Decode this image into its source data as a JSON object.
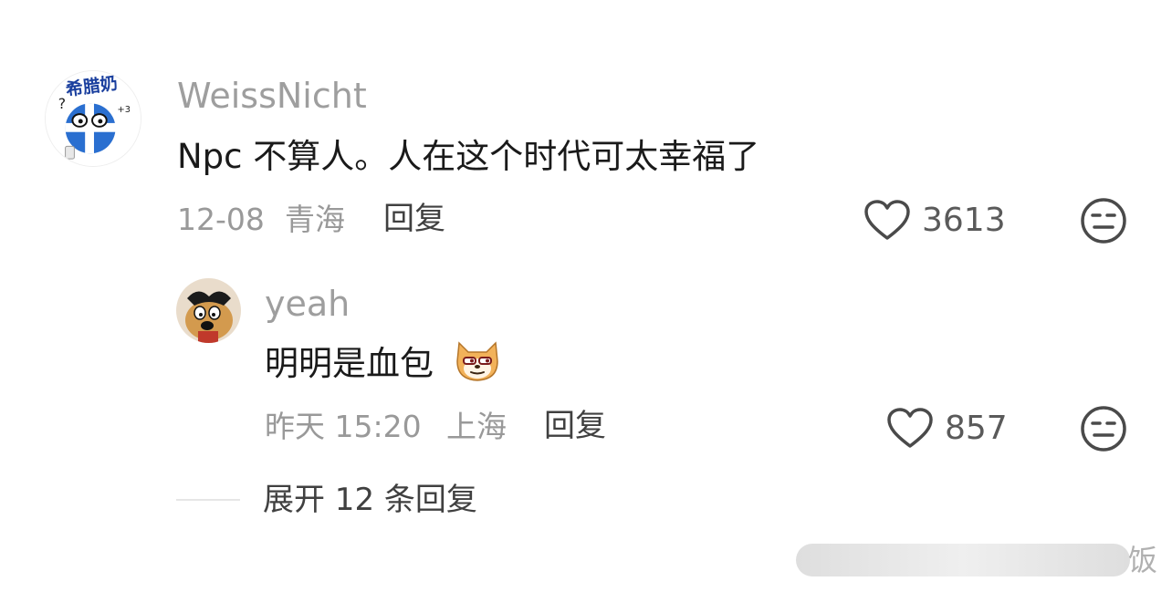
{
  "comment": {
    "username": "WeissNicht",
    "text": "Npc 不算人。人在这个时代可太幸福了",
    "date": "12-08",
    "location": "青海",
    "reply_label": "回复",
    "likes": "3613",
    "avatar_text": "希腊奶"
  },
  "reply": {
    "username": "yeah",
    "text": "明明是血包",
    "emoji": "doge-shiba-emoji",
    "date": "昨天 15:20",
    "location": "上海",
    "reply_label": "回复",
    "likes": "857"
  },
  "expand": {
    "label": "展开 12 条回复"
  },
  "watermark": {
    "text": "饭"
  },
  "colors": {
    "username": "#9e9e9e",
    "text": "#1a1a1a",
    "meta": "#999999",
    "icon": "#4a4a4a"
  }
}
